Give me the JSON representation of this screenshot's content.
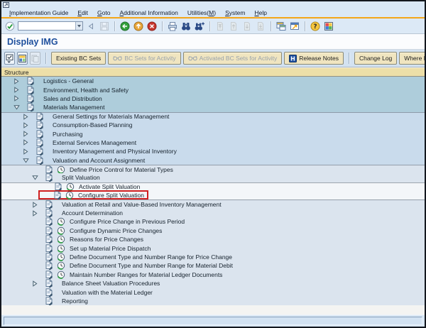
{
  "page": {
    "title": "Display IMG"
  },
  "menu_bar": {
    "items": [
      {
        "label": "Implementation Guide",
        "underline": 0
      },
      {
        "label": "Edit",
        "underline": 0
      },
      {
        "label": "Goto",
        "underline": 0
      },
      {
        "label": "Additional Information",
        "underline": 0
      },
      {
        "label": "Utilities(M)",
        "underline": 10
      },
      {
        "label": "System",
        "underline": 0
      },
      {
        "label": "Help",
        "underline": 0
      }
    ]
  },
  "toolbar": {
    "command_field": {
      "value": "",
      "placeholder": ""
    },
    "items": [
      {
        "name": "enter",
        "enabled": true
      },
      {
        "name": "command-field"
      },
      {
        "name": "collapse",
        "enabled": true
      },
      {
        "name": "save",
        "enabled": false
      },
      {
        "name": "sep"
      },
      {
        "name": "back",
        "enabled": true
      },
      {
        "name": "exit",
        "enabled": true
      },
      {
        "name": "cancel",
        "enabled": true
      },
      {
        "name": "sep"
      },
      {
        "name": "print",
        "enabled": true
      },
      {
        "name": "find",
        "enabled": true
      },
      {
        "name": "find-next",
        "enabled": true
      },
      {
        "name": "sep"
      },
      {
        "name": "first-page",
        "enabled": false
      },
      {
        "name": "page-up",
        "enabled": false
      },
      {
        "name": "page-down",
        "enabled": false
      },
      {
        "name": "last-page",
        "enabled": false
      },
      {
        "name": "sep"
      },
      {
        "name": "new-session",
        "enabled": true
      },
      {
        "name": "create-shortcut",
        "enabled": true
      },
      {
        "name": "sep"
      },
      {
        "name": "help",
        "enabled": true
      },
      {
        "name": "customize-layout",
        "enabled": true
      }
    ]
  },
  "app_toolbar": {
    "icon_buttons": [
      {
        "name": "position",
        "enabled": true
      },
      {
        "name": "legend",
        "enabled": true
      },
      {
        "name": "copy",
        "enabled": false
      }
    ],
    "buttons": [
      {
        "label": "Existing BC Sets",
        "enabled": true,
        "icon": null,
        "sep_before": true
      },
      {
        "label": "BC Sets for Activity",
        "enabled": false,
        "icon": "glasses",
        "sep_before": false
      },
      {
        "label": "Activated BC Sets for Activity",
        "enabled": false,
        "icon": "glasses",
        "sep_before": false
      },
      {
        "label": "Release Notes",
        "enabled": true,
        "icon": "release-notes",
        "sep_before": false
      },
      {
        "label": "Change Log",
        "enabled": true,
        "icon": null,
        "sep_before": true
      },
      {
        "label": "Where Else Used",
        "enabled": true,
        "icon": null,
        "sep_before": false
      }
    ]
  },
  "structure_header": {
    "label": "Structure"
  },
  "tree": {
    "level_colors": [
      "#aecddb",
      "#c9dbec",
      "#dbe4ee",
      "#f3f6f9"
    ],
    "highlight_color": "#d02020",
    "rows": [
      {
        "label": "Logistics - General",
        "level": 0,
        "kind": "folder",
        "expander": "collapsed",
        "highlighted": false
      },
      {
        "label": "Environment, Health and Safety",
        "level": 0,
        "kind": "folder",
        "expander": "collapsed",
        "highlighted": false
      },
      {
        "label": "Sales and Distribution",
        "level": 0,
        "kind": "folder",
        "expander": "collapsed",
        "highlighted": false
      },
      {
        "label": "Materials Management",
        "level": 0,
        "kind": "folder",
        "expander": "expanded",
        "highlighted": false
      },
      {
        "label": "General Settings for Materials Management",
        "level": 1,
        "kind": "folder",
        "expander": "collapsed",
        "highlighted": false
      },
      {
        "label": "Consumption-Based Planning",
        "level": 1,
        "kind": "folder",
        "expander": "collapsed",
        "highlighted": false
      },
      {
        "label": "Purchasing",
        "level": 1,
        "kind": "folder",
        "expander": "collapsed",
        "highlighted": false
      },
      {
        "label": "External Services Management",
        "level": 1,
        "kind": "folder",
        "expander": "collapsed",
        "highlighted": false
      },
      {
        "label": "Inventory Management and Physical Inventory",
        "level": 1,
        "kind": "folder",
        "expander": "collapsed",
        "highlighted": false
      },
      {
        "label": "Valuation and Account Assignment",
        "level": 1,
        "kind": "folder",
        "expander": "expanded",
        "highlighted": false
      },
      {
        "label": "Define Price Control for Material Types",
        "level": 2,
        "kind": "activity",
        "expander": "none",
        "highlighted": false
      },
      {
        "label": "Split Valuation",
        "level": 2,
        "kind": "folder",
        "expander": "expanded",
        "highlighted": false
      },
      {
        "label": "Activate Split Valuation",
        "level": 3,
        "kind": "activity",
        "expander": "none",
        "highlighted": false
      },
      {
        "label": "Configure Split Valuation",
        "level": 3,
        "kind": "activity",
        "expander": "none",
        "highlighted": true
      },
      {
        "label": "Valuation at Retail and Value-Based Inventory Management",
        "level": 2,
        "kind": "folder",
        "expander": "collapsed",
        "highlighted": false
      },
      {
        "label": "Account Determination",
        "level": 2,
        "kind": "folder",
        "expander": "collapsed",
        "highlighted": false
      },
      {
        "label": "Configure Price Change in Previous Period",
        "level": 2,
        "kind": "activity",
        "expander": "none",
        "highlighted": false
      },
      {
        "label": "Configure Dynamic Price Changes",
        "level": 2,
        "kind": "activity",
        "expander": "none",
        "highlighted": false
      },
      {
        "label": "Reasons for Price Changes",
        "level": 2,
        "kind": "activity",
        "expander": "none",
        "highlighted": false
      },
      {
        "label": "Set up Material Price Dispatch",
        "level": 2,
        "kind": "activity",
        "expander": "none",
        "highlighted": false
      },
      {
        "label": "Define Document Type and Number Range for Price Change",
        "level": 2,
        "kind": "activity",
        "expander": "none",
        "highlighted": false
      },
      {
        "label": "Define Document Type and Number Range for Material Debit",
        "level": 2,
        "kind": "activity",
        "expander": "none",
        "highlighted": false
      },
      {
        "label": "Maintain Number Ranges for Material Ledger Documents",
        "level": 2,
        "kind": "activity",
        "expander": "none",
        "highlighted": false
      },
      {
        "label": "Balance Sheet Valuation Procedures",
        "level": 2,
        "kind": "folder",
        "expander": "collapsed",
        "highlighted": false
      },
      {
        "label": "Valuation with the Material Ledger",
        "level": 2,
        "kind": "folder",
        "expander": "none",
        "highlighted": false
      },
      {
        "label": "Reporting",
        "level": 2,
        "kind": "folder",
        "expander": "none",
        "highlighted": false
      }
    ]
  },
  "status_bar": {
    "text": ""
  }
}
